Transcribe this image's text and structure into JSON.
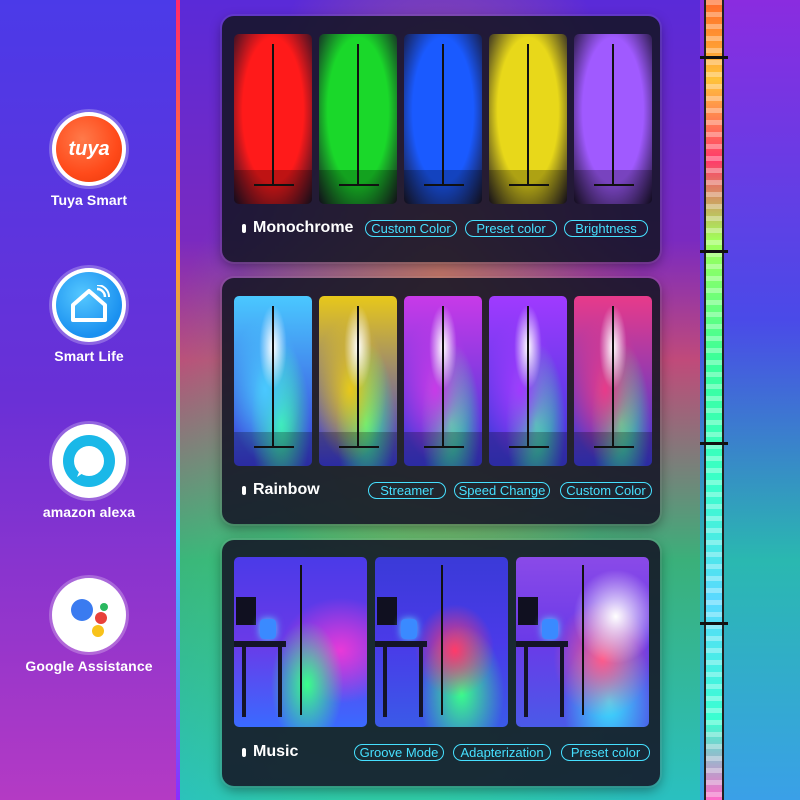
{
  "apps": [
    {
      "label": "Tuya Smart",
      "logo_text": "tuya",
      "icon": "tuya-logo-icon"
    },
    {
      "label": "Smart Life",
      "icon": "smart-life-home-icon"
    },
    {
      "label": "amazon alexa",
      "icon": "alexa-ring-icon"
    },
    {
      "label": "Google Assistance",
      "icon": "google-assistant-dots-icon"
    }
  ],
  "modes": [
    {
      "label": "Monochrome",
      "tags": [
        "Custom Color",
        "Preset color",
        "Brightness"
      ],
      "tile_colors": [
        "#ff1a1a",
        "#1ad82a",
        "#1a5aff",
        "#e8d81a",
        "#a05aff"
      ]
    },
    {
      "label": "Rainbow",
      "tags": [
        "Streamer",
        "Speed Change",
        "Custom Color"
      ],
      "tile_colors": [
        "#4ac8ff",
        "#e8c81a",
        "#c83ae8",
        "#a03aff",
        "#e83a8a"
      ]
    },
    {
      "label": "Music",
      "tags": [
        "Groove Mode",
        "Adapterization",
        "Preset color"
      ]
    }
  ],
  "colors": {
    "accent_tag": "#46e0ff",
    "panel_bg": "#141426"
  }
}
